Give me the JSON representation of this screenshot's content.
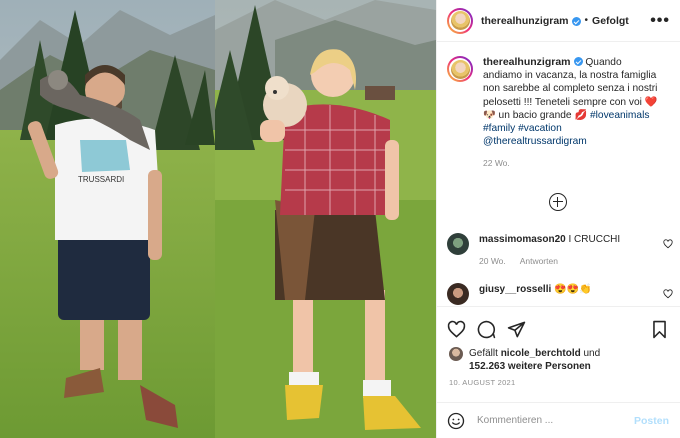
{
  "post": {
    "author": "therealhunzigram",
    "follow_label": "Gefolgt",
    "more_label": "•••"
  },
  "caption": {
    "username": "therealhunzigram",
    "text": "Quando andiamo in vacanza, la nostra famiglia non sarebbe al completo senza i nostri pelosetti !!! Teneteli sempre con voi",
    "text2": "un bacio grande",
    "tags": [
      "#loveanimals",
      "#family",
      "#vacation",
      "@therealtrussardigram"
    ],
    "time": "22 Wo."
  },
  "comments": [
    {
      "user": "massimomason20",
      "text": "I CRUCCHI",
      "time": "20 Wo.",
      "reply_label": "Antworten"
    },
    {
      "user": "giusy__rosselli",
      "text": "😍😍👏"
    }
  ],
  "likes": {
    "prefix": "Gefällt",
    "user": "nicole_berchtold",
    "conjunction": "und",
    "others": "152.263 weitere Personen"
  },
  "date": "10. AUGUST 2021",
  "comment_box": {
    "placeholder": "Kommentieren ...",
    "post_label": "Posten"
  },
  "photo": {
    "logo_text": "TRUSSARDI"
  }
}
